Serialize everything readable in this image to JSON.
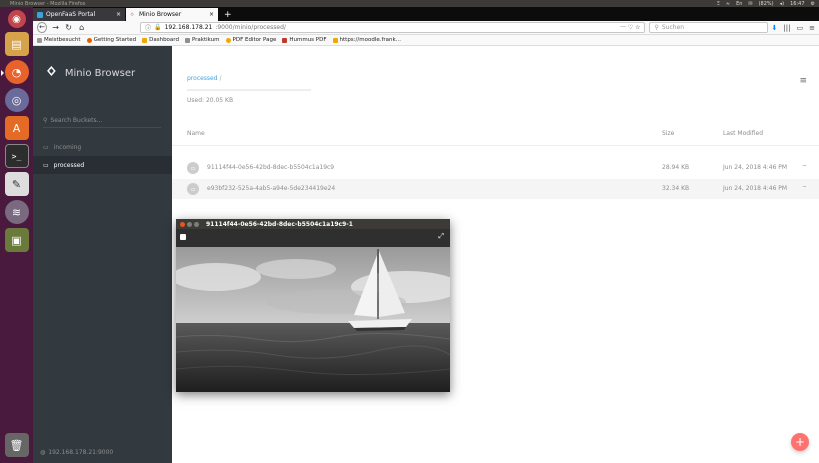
{
  "os": {
    "window_title": "Minio Browser - Mozilla Firefox",
    "tray": [
      "Ξ",
      "≈",
      "En",
      "✉",
      "(82%)",
      "◂)",
      "16:47",
      "⚙"
    ]
  },
  "browser": {
    "tabs": [
      {
        "label": "OpenFaaS Portal",
        "active": false
      },
      {
        "label": "Minio Browser",
        "active": true
      }
    ],
    "url_host": "192.168.178.21",
    "url_path": ":9000/minio/processed/",
    "url_actions": "··· ♡ ☆",
    "search_placeholder": "Suchen",
    "bookmarks": [
      {
        "label": "Meistbesucht",
        "color": "#999999"
      },
      {
        "label": "Getting Started",
        "color": "#e66000"
      },
      {
        "label": "Dashboard",
        "color": "#f2a600"
      },
      {
        "label": "Praktikum",
        "color": "#8e8e8e"
      },
      {
        "label": "PDF Editor Page",
        "color": "#f2a600"
      },
      {
        "label": "Hummus PDF",
        "color": "#c0392b"
      },
      {
        "label": "https://moodle.frank...",
        "color": "#f2a600"
      }
    ]
  },
  "sidebar": {
    "brand": "Minio Browser",
    "search_placeholder": "Search Buckets...",
    "buckets": [
      {
        "label": "incoming",
        "active": false
      },
      {
        "label": "processed",
        "active": true
      }
    ],
    "server": "192.168.178.21:9000"
  },
  "main": {
    "breadcrumb": "processed",
    "breadcrumb_sep": "/",
    "usage": "Used: 20.05 KB",
    "columns": {
      "name": "Name",
      "size": "Size",
      "modified": "Last Modified"
    },
    "files": [
      {
        "name": "91114f44-0e56-42bd-8dec-b5504c1a19c9",
        "size": "28.94 KB",
        "modified": "Jun 24, 2018 4:46 PM"
      },
      {
        "name": "e93bf232-525a-4ab5-a94e-5de234419e24",
        "size": "32.34 KB",
        "modified": "Jun 24, 2018 4:46 PM"
      }
    ],
    "row_actions": "···"
  },
  "preview": {
    "title": "91114f44-0e56-42bd-8dec-b5504c1a19c9-1"
  }
}
